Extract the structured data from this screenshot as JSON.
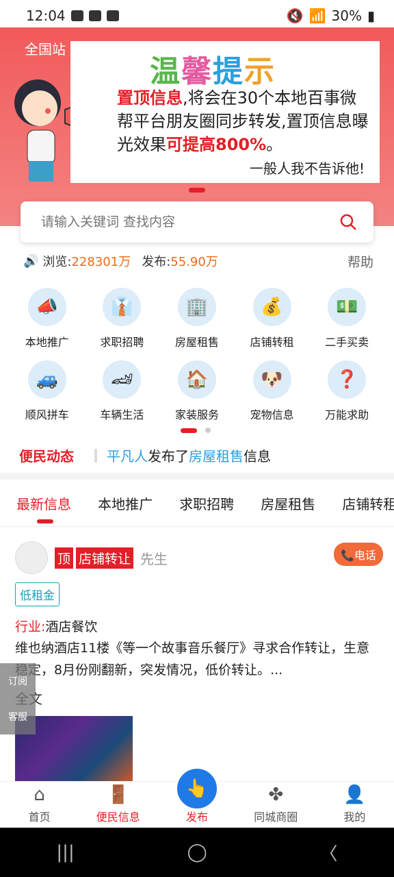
{
  "status": {
    "time": "12:04",
    "battery": "30%"
  },
  "banner": {
    "city": "全国站",
    "title": [
      "温",
      "馨",
      "提",
      "示"
    ],
    "line1_red": "置顶信息",
    "line1_rest": ",将会在30个本地百事微帮平台朋友圈同步转发,置顶信息曝光效果",
    "line1_red2": "可提高800%",
    "line1_end": "。",
    "sign": "一般人我不告诉他!"
  },
  "search": {
    "placeholder": "请输入关键词 查找内容"
  },
  "stats": {
    "views_label": "浏览: ",
    "views": "228301万",
    "posts_label": "发布: ",
    "posts": "55.90万",
    "help": "帮助"
  },
  "categories": [
    {
      "label": "本地推广",
      "icon": "megaphone-icon",
      "glyph": "📣"
    },
    {
      "label": "求职招聘",
      "icon": "job-icon",
      "glyph": "👔"
    },
    {
      "label": "房屋租售",
      "icon": "building-icon",
      "glyph": "🏢"
    },
    {
      "label": "店铺转租",
      "icon": "money-bag-icon",
      "glyph": "💰"
    },
    {
      "label": "二手买卖",
      "icon": "trade-icon",
      "glyph": "💵"
    },
    {
      "label": "顺风拼车",
      "icon": "car-icon",
      "glyph": "🚙"
    },
    {
      "label": "车辆生活",
      "icon": "sports-car-icon",
      "glyph": "🏎"
    },
    {
      "label": "家装服务",
      "icon": "house-icon",
      "glyph": "🏠"
    },
    {
      "label": "宠物信息",
      "icon": "dog-icon",
      "glyph": "🐶"
    },
    {
      "label": "万能求助",
      "icon": "question-icon",
      "glyph": "❓"
    }
  ],
  "news": {
    "tag": "便民动态",
    "user": "平凡人",
    "mid": "发布了",
    "category": "房屋租售",
    "end": "信息"
  },
  "tabs": [
    "最新信息",
    "本地推广",
    "求职招聘",
    "房屋租售",
    "店铺转租"
  ],
  "post": {
    "top": "顶",
    "category": "店铺转让",
    "name": "先生",
    "call": "📞电话",
    "badge": "低租金",
    "industry_key": "行业:",
    "industry_val": "酒店餐饮",
    "desc": "维也纳酒店11楼《等一个故事音乐餐厅》寻求合作转让，生意稳定，8月份刚翻新，突发情况，低价转让。...",
    "full": "全文"
  },
  "float": {
    "subscribe": "订阅",
    "service": "客服"
  },
  "bottom": [
    {
      "label": "首页",
      "icon": "home-icon",
      "glyph": "⌂"
    },
    {
      "label": "便民信息",
      "icon": "door-icon",
      "glyph": "🚪"
    },
    {
      "label": "发布",
      "icon": "tap-icon",
      "glyph": "👆"
    },
    {
      "label": "同城商圈",
      "icon": "grid-icon",
      "glyph": "✤"
    },
    {
      "label": "我的",
      "icon": "user-icon",
      "glyph": "👤"
    }
  ]
}
